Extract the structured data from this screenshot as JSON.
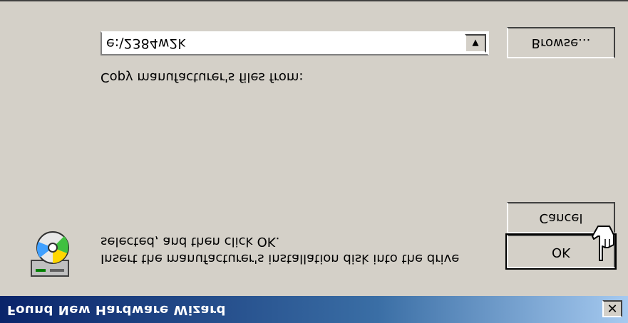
{
  "window": {
    "title": "Found New Hardware Wizard",
    "close_glyph": "✕"
  },
  "message": {
    "line1": "Insert the manufacturer's installation disk into the drive",
    "line2": "selected, and then click OK."
  },
  "buttons": {
    "ok": "OK",
    "cancel": "Cancel",
    "browse": "Browse..."
  },
  "copy_from": {
    "label": "Copy manufacturer's files from:",
    "value": "e:\\2384w2k",
    "dropdown_glyph": "▼"
  },
  "icons": {
    "disk": "cd-drive-icon",
    "cursor": "hand-cursor-icon"
  }
}
